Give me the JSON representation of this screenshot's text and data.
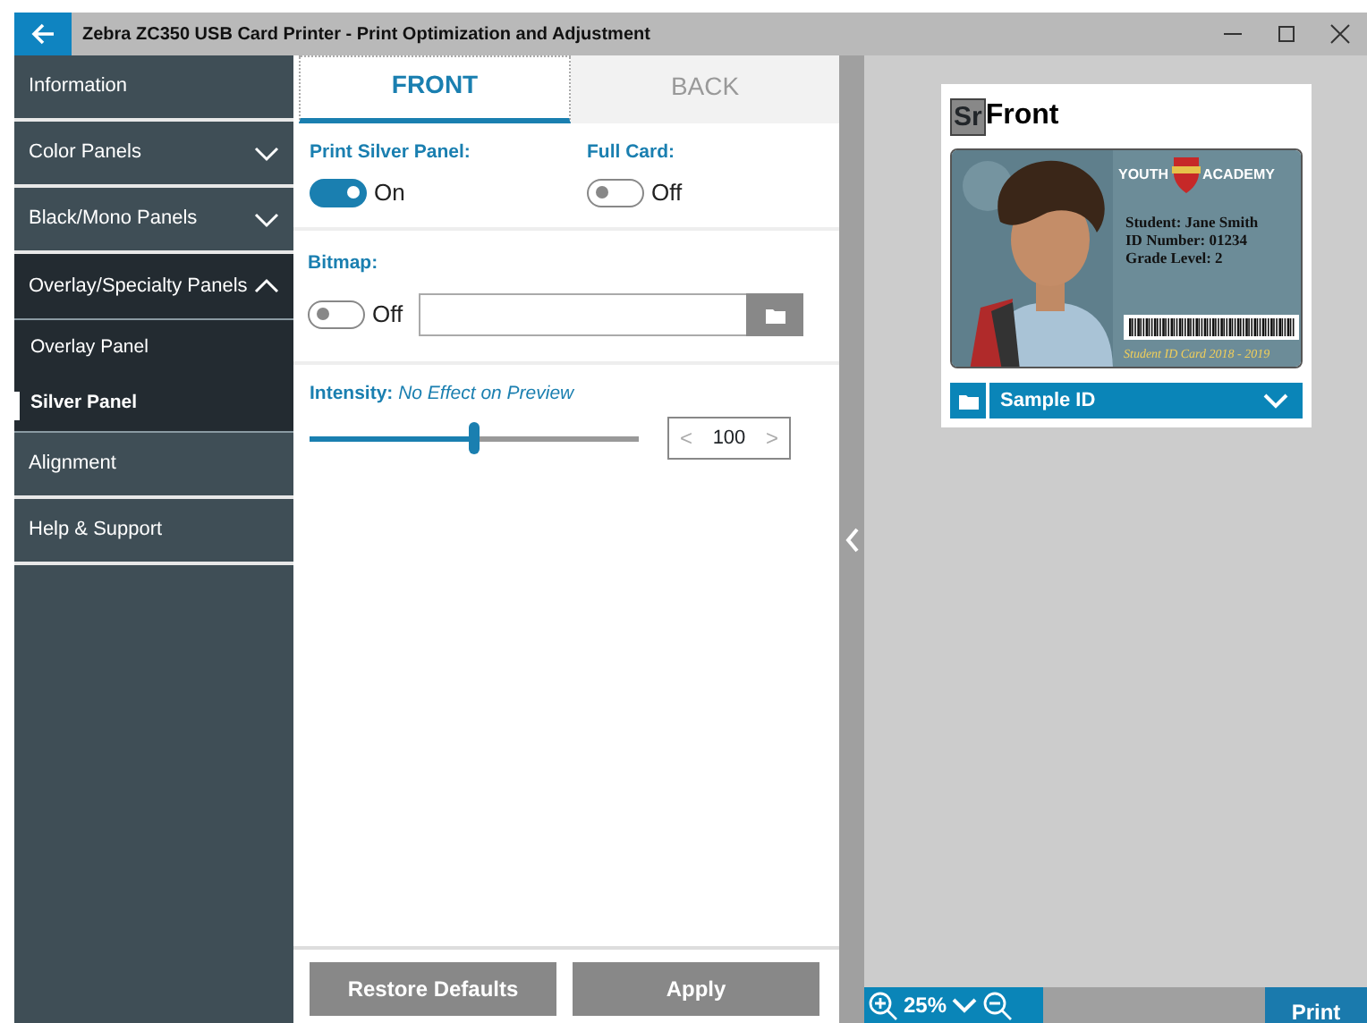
{
  "window": {
    "title": "Zebra ZC350 USB Card Printer - Print Optimization and Adjustment"
  },
  "sidebar": {
    "items": [
      {
        "label": "Information",
        "kind": "link"
      },
      {
        "label": "Color Panels",
        "kind": "group",
        "expanded": false
      },
      {
        "label": "Black/Mono Panels",
        "kind": "group",
        "expanded": false
      },
      {
        "label": "Overlay/Specialty Panels",
        "kind": "group",
        "expanded": true,
        "children": [
          {
            "label": "Overlay Panel",
            "selected": false
          },
          {
            "label": "Silver Panel",
            "selected": true
          }
        ]
      },
      {
        "label": "Alignment",
        "kind": "link"
      },
      {
        "label": "Help & Support",
        "kind": "link"
      }
    ]
  },
  "tabs": [
    {
      "label": "FRONT",
      "selected": true
    },
    {
      "label": "BACK",
      "selected": false
    }
  ],
  "panel_options": [
    {
      "label": "Print Silver Panel:",
      "on": true,
      "state_text": "On"
    },
    {
      "label": "Full Card:",
      "on": false,
      "state_text": "Off"
    }
  ],
  "bitmap": {
    "label": "Bitmap:",
    "on": false,
    "state_text": "Off"
  },
  "intensity": {
    "label": "Intensity:",
    "hint": "No Effect on Preview",
    "level": 0.5,
    "spinner": {
      "decrement": "<",
      "value": "100",
      "increment": ">"
    }
  },
  "buttons": [
    "Restore Defaults",
    "Apply"
  ],
  "preview": {
    "side_badge": "Sr",
    "title": "Front",
    "card": {
      "kind": "picture",
      "school_left": "YOUTH",
      "school_right": "ACADEMY",
      "lines": [
        "Student: Jane Smith",
        "ID Number: 01234",
        "Grade Level: 2"
      ],
      "footer": "Student ID Card 2018 - 2019"
    },
    "template": "Sample ID"
  },
  "zoom": {
    "value": "25%"
  },
  "print_button": "Print"
}
